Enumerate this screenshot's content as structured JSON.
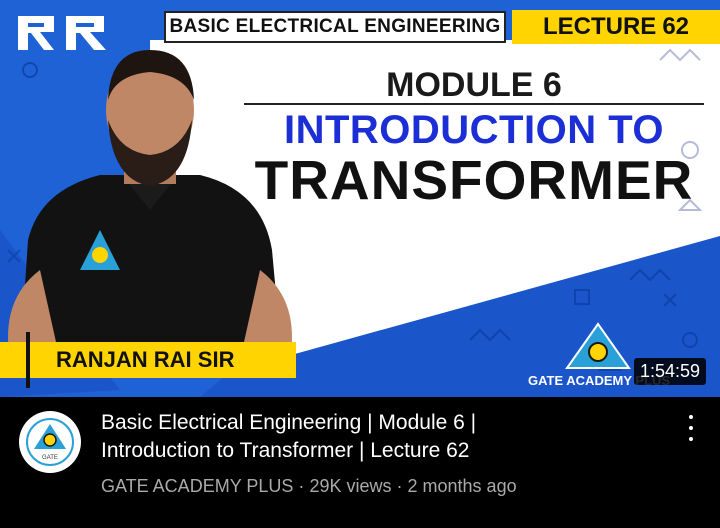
{
  "thumbnail": {
    "logo_text": "RR",
    "subject": "BASIC ELECTRICAL ENGINEERING",
    "lecture_label": "LECTURE",
    "lecture_number": "62",
    "module": "MODULE 6",
    "heading_line1": "INTRODUCTION TO",
    "heading_line2": "TRANSFORMER",
    "presenter": "RANJAN RAI SIR",
    "brand": "GATE ACADEMY PLUS",
    "duration": "1:54:59",
    "colors": {
      "background_blue": "#1f62d6",
      "accent_yellow": "#ffd400",
      "title_blue": "#1c2fd6"
    }
  },
  "video": {
    "title_line1": "Basic Electrical Engineering | Module 6 |",
    "title_line2": "Introduction to Transformer | Lecture 62",
    "channel": "GATE ACADEMY PLUS",
    "views": "29K views",
    "age": "2 months ago",
    "separator": "·",
    "avatar_text": "GATE",
    "menu_icon": "more-vert-icon"
  }
}
